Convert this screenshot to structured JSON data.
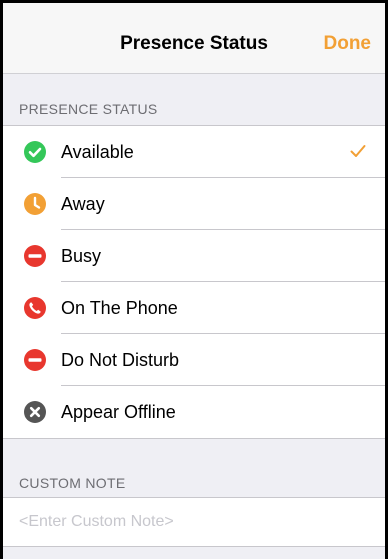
{
  "navbar": {
    "title": "Presence Status",
    "done_label": "Done"
  },
  "presence": {
    "header": "PRESENCE STATUS",
    "selected": "Available",
    "items": [
      {
        "label": "Available",
        "icon": "available-check-icon",
        "color": "#34c759"
      },
      {
        "label": "Away",
        "icon": "away-clock-icon",
        "color": "#f2a035"
      },
      {
        "label": "Busy",
        "icon": "busy-minus-icon",
        "color": "#e8372e"
      },
      {
        "label": "On The Phone",
        "icon": "phone-icon",
        "color": "#e8372e"
      },
      {
        "label": "Do Not Disturb",
        "icon": "do-not-disturb-icon",
        "color": "#e8372e"
      },
      {
        "label": "Appear Offline",
        "icon": "offline-x-icon",
        "color": "#555555"
      }
    ]
  },
  "custom_note": {
    "header": "CUSTOM NOTE",
    "placeholder": "<Enter Custom Note>",
    "value": ""
  },
  "colors": {
    "accent": "#f2a035",
    "background": "#efeff4"
  }
}
